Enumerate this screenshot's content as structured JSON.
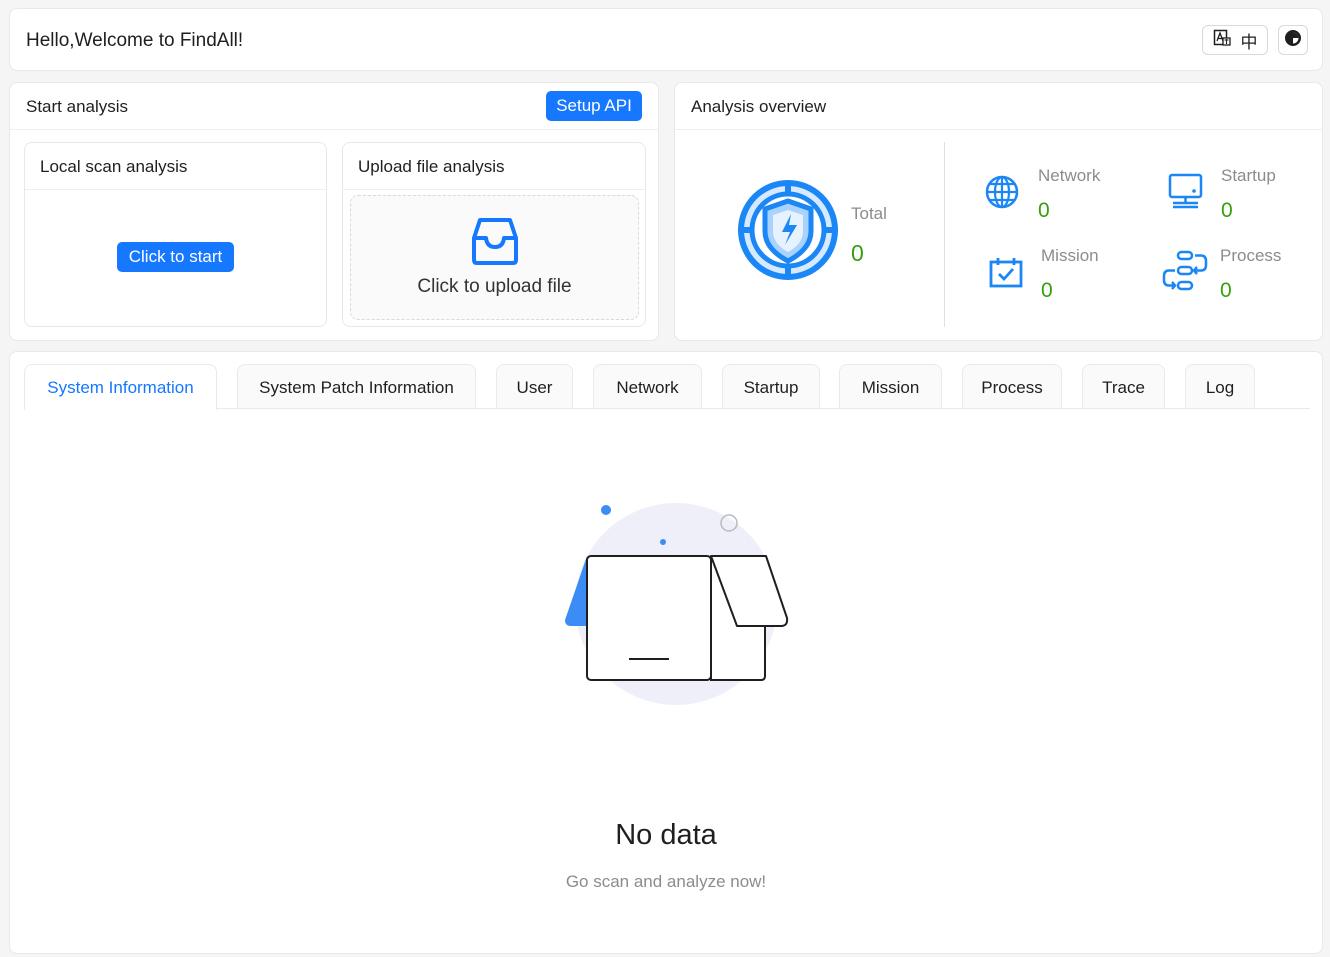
{
  "header": {
    "title": "Hello,Welcome to FindAll!",
    "lang_label": "中"
  },
  "start": {
    "title": "Start analysis",
    "setup_api": "Setup API",
    "local": {
      "title": "Local scan analysis",
      "button": "Click to start"
    },
    "upload": {
      "title": "Upload file analysis",
      "prompt": "Click to upload file"
    }
  },
  "overview": {
    "title": "Analysis overview",
    "total": {
      "label": "Total",
      "value": "0"
    },
    "network": {
      "label": "Network",
      "value": "0"
    },
    "startup": {
      "label": "Startup",
      "value": "0"
    },
    "mission": {
      "label": "Mission",
      "value": "0"
    },
    "process": {
      "label": "Process",
      "value": "0"
    }
  },
  "tabs": [
    {
      "label": "System Information",
      "active": true
    },
    {
      "label": "System Patch Information"
    },
    {
      "label": "User"
    },
    {
      "label": "Network"
    },
    {
      "label": "Startup"
    },
    {
      "label": "Mission"
    },
    {
      "label": "Process"
    },
    {
      "label": "Trace"
    },
    {
      "label": "Log"
    }
  ],
  "empty": {
    "title": "No data",
    "subtitle": "Go scan and analyze now!"
  },
  "colors": {
    "accent": "#1677ff",
    "success": "#389e0d",
    "muted": "#8c8c8c"
  }
}
